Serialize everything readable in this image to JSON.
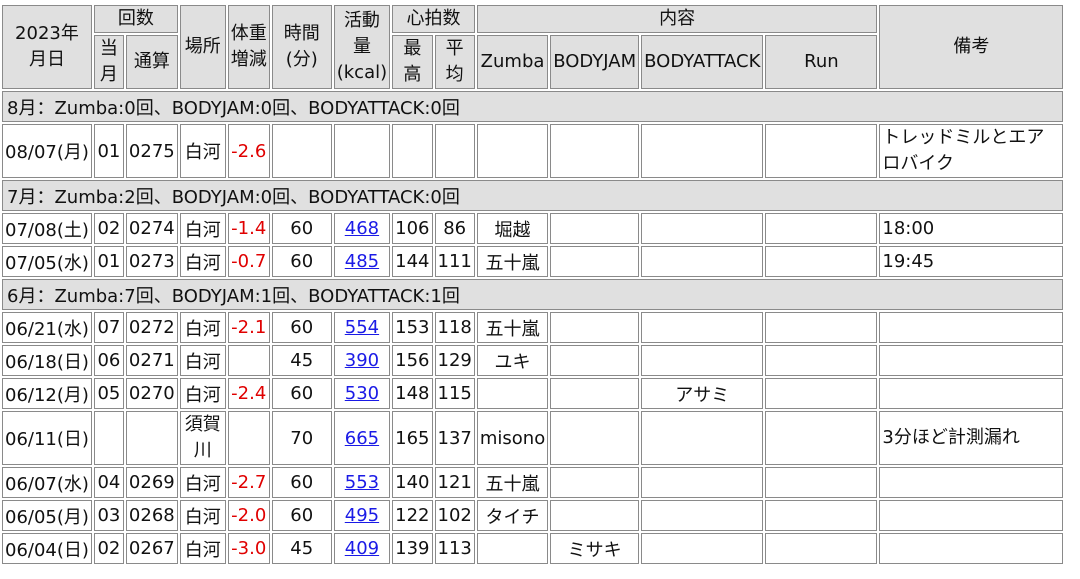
{
  "header": {
    "date": "2023年\n月日",
    "count": "回数",
    "count_month": "当\n月",
    "count_total": "通算",
    "place": "場所",
    "weight": "体重\n増減",
    "time": "時間\n(分)",
    "kcal": "活動\n量\n(kcal)",
    "hr": "心拍数",
    "hr_max": "最\n高",
    "hr_avg": "平\n均",
    "content": "内容",
    "zumba": "Zumba",
    "bodyjam": "BODYJAM",
    "bodyattack": "BODYATTACK",
    "run": "Run",
    "notes": "備考"
  },
  "months": [
    {
      "title": "8月：Zumba:0回、BODYJAM:0回、BODYATTACK:0回",
      "rows": [
        {
          "date": "08/07(月)",
          "month": "01",
          "total": "0275",
          "place": "白河",
          "weight": "-2.6",
          "time": "",
          "kcal": "",
          "hrmax": "",
          "hravg": "",
          "zumba": "",
          "bodyjam": "",
          "bodyattack": "",
          "run": "",
          "notes": "トレッドミルとエアロバイク"
        }
      ]
    },
    {
      "title": "7月：Zumba:2回、BODYJAM:0回、BODYATTACK:0回",
      "rows": [
        {
          "date": "07/08(土)",
          "month": "02",
          "total": "0274",
          "place": "白河",
          "weight": "-1.4",
          "time": "60",
          "kcal": "468",
          "hrmax": "106",
          "hravg": "86",
          "zumba": "堀越",
          "bodyjam": "",
          "bodyattack": "",
          "run": "",
          "notes": "18:00"
        },
        {
          "date": "07/05(水)",
          "month": "01",
          "total": "0273",
          "place": "白河",
          "weight": "-0.7",
          "time": "60",
          "kcal": "485",
          "hrmax": "144",
          "hravg": "111",
          "zumba": "五十嵐",
          "bodyjam": "",
          "bodyattack": "",
          "run": "",
          "notes": "19:45"
        }
      ]
    },
    {
      "title": "6月：Zumba:7回、BODYJAM:1回、BODYATTACK:1回",
      "rows": [
        {
          "date": "06/21(水)",
          "month": "07",
          "total": "0272",
          "place": "白河",
          "weight": "-2.1",
          "time": "60",
          "kcal": "554",
          "hrmax": "153",
          "hravg": "118",
          "zumba": "五十嵐",
          "bodyjam": "",
          "bodyattack": "",
          "run": "",
          "notes": ""
        },
        {
          "date": "06/18(日)",
          "month": "06",
          "total": "0271",
          "place": "白河",
          "weight": "",
          "time": "45",
          "kcal": "390",
          "hrmax": "156",
          "hravg": "129",
          "zumba": "ユキ",
          "bodyjam": "",
          "bodyattack": "",
          "run": "",
          "notes": ""
        },
        {
          "date": "06/12(月)",
          "month": "05",
          "total": "0270",
          "place": "白河",
          "weight": "-2.4",
          "time": "60",
          "kcal": "530",
          "hrmax": "148",
          "hravg": "115",
          "zumba": "",
          "bodyjam": "",
          "bodyattack": "アサミ",
          "run": "",
          "notes": ""
        },
        {
          "date": "06/11(日)",
          "month": "",
          "total": "",
          "place": "須賀川",
          "weight": "",
          "time": "70",
          "kcal": "665",
          "hrmax": "165",
          "hravg": "137",
          "zumba": "misono",
          "bodyjam": "",
          "bodyattack": "",
          "run": "",
          "notes": "3分ほど計測漏れ"
        },
        {
          "date": "06/07(水)",
          "month": "04",
          "total": "0269",
          "place": "白河",
          "weight": "-2.7",
          "time": "60",
          "kcal": "553",
          "hrmax": "140",
          "hravg": "121",
          "zumba": "五十嵐",
          "bodyjam": "",
          "bodyattack": "",
          "run": "",
          "notes": ""
        },
        {
          "date": "06/05(月)",
          "month": "03",
          "total": "0268",
          "place": "白河",
          "weight": "-2.0",
          "time": "60",
          "kcal": "495",
          "hrmax": "122",
          "hravg": "102",
          "zumba": "タイチ",
          "bodyjam": "",
          "bodyattack": "",
          "run": "",
          "notes": ""
        },
        {
          "date": "06/04(日)",
          "month": "02",
          "total": "0267",
          "place": "白河",
          "weight": "-3.0",
          "time": "45",
          "kcal": "409",
          "hrmax": "139",
          "hravg": "113",
          "zumba": "",
          "bodyjam": "ミサキ",
          "bodyattack": "",
          "run": "",
          "notes": ""
        }
      ]
    }
  ],
  "colors": {
    "negative": "#e00000",
    "link": "#1a1ae6",
    "header_bg": "#e0e0e0",
    "border": "#8a8a8a"
  }
}
